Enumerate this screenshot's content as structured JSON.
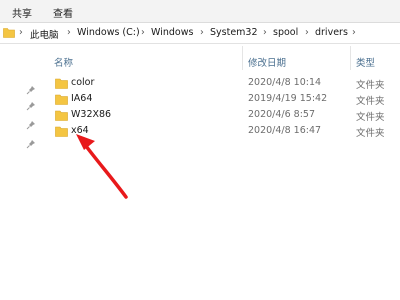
{
  "ribbon": {
    "tabs": [
      "共享",
      "查看"
    ]
  },
  "address": {
    "crumbs": [
      "此电脑",
      "Windows (C:)",
      "Windows",
      "System32",
      "spool",
      "drivers"
    ]
  },
  "columns": {
    "name": "名称",
    "date": "修改日期",
    "type": "类型"
  },
  "files": [
    {
      "name": "color",
      "date": "2020/4/8 10:14",
      "type": "文件夹"
    },
    {
      "name": "IA64",
      "date": "2019/4/19 15:42",
      "type": "文件夹"
    },
    {
      "name": "W32X86",
      "date": "2020/4/6 8:57",
      "type": "文件夹"
    },
    {
      "name": "x64",
      "date": "2020/4/8 16:47",
      "type": "文件夹"
    }
  ],
  "icons": {
    "folder": "folder-icon",
    "pin": "pin-icon",
    "chevron": "chevron-right-icon"
  },
  "colors": {
    "folder": "#f4c542",
    "accent": "#4a6f8f",
    "arrow": "#e8191b"
  }
}
